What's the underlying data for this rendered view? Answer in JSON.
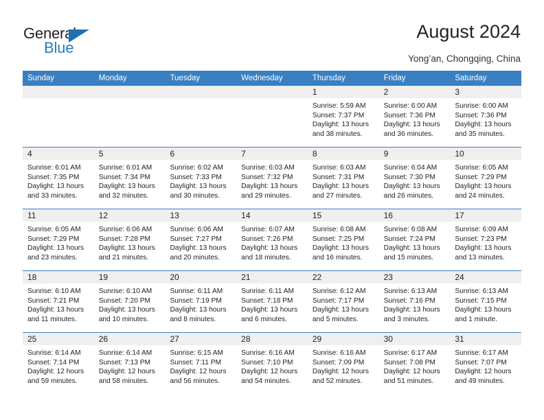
{
  "brand": {
    "name_part1": "General",
    "name_part2": "Blue"
  },
  "header": {
    "title": "August 2024",
    "subtitle": "Yong’an, Chongqing, China"
  },
  "calendar": {
    "day_headers": [
      "Sunday",
      "Monday",
      "Tuesday",
      "Wednesday",
      "Thursday",
      "Friday",
      "Saturday"
    ],
    "colors": {
      "header_blue": "#3880c2",
      "daynum_band": "#efefef",
      "brand_blue": "#1f7ec4",
      "text": "#222222"
    },
    "weeks": [
      [
        {
          "day": "",
          "sunrise": "",
          "sunset": "",
          "daylight_line1": "",
          "daylight_line2": ""
        },
        {
          "day": "",
          "sunrise": "",
          "sunset": "",
          "daylight_line1": "",
          "daylight_line2": ""
        },
        {
          "day": "",
          "sunrise": "",
          "sunset": "",
          "daylight_line1": "",
          "daylight_line2": ""
        },
        {
          "day": "",
          "sunrise": "",
          "sunset": "",
          "daylight_line1": "",
          "daylight_line2": ""
        },
        {
          "day": "1",
          "sunrise": "Sunrise: 5:59 AM",
          "sunset": "Sunset: 7:37 PM",
          "daylight_line1": "Daylight: 13 hours",
          "daylight_line2": "and 38 minutes."
        },
        {
          "day": "2",
          "sunrise": "Sunrise: 6:00 AM",
          "sunset": "Sunset: 7:36 PM",
          "daylight_line1": "Daylight: 13 hours",
          "daylight_line2": "and 36 minutes."
        },
        {
          "day": "3",
          "sunrise": "Sunrise: 6:00 AM",
          "sunset": "Sunset: 7:36 PM",
          "daylight_line1": "Daylight: 13 hours",
          "daylight_line2": "and 35 minutes."
        }
      ],
      [
        {
          "day": "4",
          "sunrise": "Sunrise: 6:01 AM",
          "sunset": "Sunset: 7:35 PM",
          "daylight_line1": "Daylight: 13 hours",
          "daylight_line2": "and 33 minutes."
        },
        {
          "day": "5",
          "sunrise": "Sunrise: 6:01 AM",
          "sunset": "Sunset: 7:34 PM",
          "daylight_line1": "Daylight: 13 hours",
          "daylight_line2": "and 32 minutes."
        },
        {
          "day": "6",
          "sunrise": "Sunrise: 6:02 AM",
          "sunset": "Sunset: 7:33 PM",
          "daylight_line1": "Daylight: 13 hours",
          "daylight_line2": "and 30 minutes."
        },
        {
          "day": "7",
          "sunrise": "Sunrise: 6:03 AM",
          "sunset": "Sunset: 7:32 PM",
          "daylight_line1": "Daylight: 13 hours",
          "daylight_line2": "and 29 minutes."
        },
        {
          "day": "8",
          "sunrise": "Sunrise: 6:03 AM",
          "sunset": "Sunset: 7:31 PM",
          "daylight_line1": "Daylight: 13 hours",
          "daylight_line2": "and 27 minutes."
        },
        {
          "day": "9",
          "sunrise": "Sunrise: 6:04 AM",
          "sunset": "Sunset: 7:30 PM",
          "daylight_line1": "Daylight: 13 hours",
          "daylight_line2": "and 26 minutes."
        },
        {
          "day": "10",
          "sunrise": "Sunrise: 6:05 AM",
          "sunset": "Sunset: 7:29 PM",
          "daylight_line1": "Daylight: 13 hours",
          "daylight_line2": "and 24 minutes."
        }
      ],
      [
        {
          "day": "11",
          "sunrise": "Sunrise: 6:05 AM",
          "sunset": "Sunset: 7:29 PM",
          "daylight_line1": "Daylight: 13 hours",
          "daylight_line2": "and 23 minutes."
        },
        {
          "day": "12",
          "sunrise": "Sunrise: 6:06 AM",
          "sunset": "Sunset: 7:28 PM",
          "daylight_line1": "Daylight: 13 hours",
          "daylight_line2": "and 21 minutes."
        },
        {
          "day": "13",
          "sunrise": "Sunrise: 6:06 AM",
          "sunset": "Sunset: 7:27 PM",
          "daylight_line1": "Daylight: 13 hours",
          "daylight_line2": "and 20 minutes."
        },
        {
          "day": "14",
          "sunrise": "Sunrise: 6:07 AM",
          "sunset": "Sunset: 7:26 PM",
          "daylight_line1": "Daylight: 13 hours",
          "daylight_line2": "and 18 minutes."
        },
        {
          "day": "15",
          "sunrise": "Sunrise: 6:08 AM",
          "sunset": "Sunset: 7:25 PM",
          "daylight_line1": "Daylight: 13 hours",
          "daylight_line2": "and 16 minutes."
        },
        {
          "day": "16",
          "sunrise": "Sunrise: 6:08 AM",
          "sunset": "Sunset: 7:24 PM",
          "daylight_line1": "Daylight: 13 hours",
          "daylight_line2": "and 15 minutes."
        },
        {
          "day": "17",
          "sunrise": "Sunrise: 6:09 AM",
          "sunset": "Sunset: 7:23 PM",
          "daylight_line1": "Daylight: 13 hours",
          "daylight_line2": "and 13 minutes."
        }
      ],
      [
        {
          "day": "18",
          "sunrise": "Sunrise: 6:10 AM",
          "sunset": "Sunset: 7:21 PM",
          "daylight_line1": "Daylight: 13 hours",
          "daylight_line2": "and 11 minutes."
        },
        {
          "day": "19",
          "sunrise": "Sunrise: 6:10 AM",
          "sunset": "Sunset: 7:20 PM",
          "daylight_line1": "Daylight: 13 hours",
          "daylight_line2": "and 10 minutes."
        },
        {
          "day": "20",
          "sunrise": "Sunrise: 6:11 AM",
          "sunset": "Sunset: 7:19 PM",
          "daylight_line1": "Daylight: 13 hours",
          "daylight_line2": "and 8 minutes."
        },
        {
          "day": "21",
          "sunrise": "Sunrise: 6:11 AM",
          "sunset": "Sunset: 7:18 PM",
          "daylight_line1": "Daylight: 13 hours",
          "daylight_line2": "and 6 minutes."
        },
        {
          "day": "22",
          "sunrise": "Sunrise: 6:12 AM",
          "sunset": "Sunset: 7:17 PM",
          "daylight_line1": "Daylight: 13 hours",
          "daylight_line2": "and 5 minutes."
        },
        {
          "day": "23",
          "sunrise": "Sunrise: 6:13 AM",
          "sunset": "Sunset: 7:16 PM",
          "daylight_line1": "Daylight: 13 hours",
          "daylight_line2": "and 3 minutes."
        },
        {
          "day": "24",
          "sunrise": "Sunrise: 6:13 AM",
          "sunset": "Sunset: 7:15 PM",
          "daylight_line1": "Daylight: 13 hours",
          "daylight_line2": "and 1 minute."
        }
      ],
      [
        {
          "day": "25",
          "sunrise": "Sunrise: 6:14 AM",
          "sunset": "Sunset: 7:14 PM",
          "daylight_line1": "Daylight: 12 hours",
          "daylight_line2": "and 59 minutes."
        },
        {
          "day": "26",
          "sunrise": "Sunrise: 6:14 AM",
          "sunset": "Sunset: 7:13 PM",
          "daylight_line1": "Daylight: 12 hours",
          "daylight_line2": "and 58 minutes."
        },
        {
          "day": "27",
          "sunrise": "Sunrise: 6:15 AM",
          "sunset": "Sunset: 7:11 PM",
          "daylight_line1": "Daylight: 12 hours",
          "daylight_line2": "and 56 minutes."
        },
        {
          "day": "28",
          "sunrise": "Sunrise: 6:16 AM",
          "sunset": "Sunset: 7:10 PM",
          "daylight_line1": "Daylight: 12 hours",
          "daylight_line2": "and 54 minutes."
        },
        {
          "day": "29",
          "sunrise": "Sunrise: 6:16 AM",
          "sunset": "Sunset: 7:09 PM",
          "daylight_line1": "Daylight: 12 hours",
          "daylight_line2": "and 52 minutes."
        },
        {
          "day": "30",
          "sunrise": "Sunrise: 6:17 AM",
          "sunset": "Sunset: 7:08 PM",
          "daylight_line1": "Daylight: 12 hours",
          "daylight_line2": "and 51 minutes."
        },
        {
          "day": "31",
          "sunrise": "Sunrise: 6:17 AM",
          "sunset": "Sunset: 7:07 PM",
          "daylight_line1": "Daylight: 12 hours",
          "daylight_line2": "and 49 minutes."
        }
      ]
    ]
  }
}
